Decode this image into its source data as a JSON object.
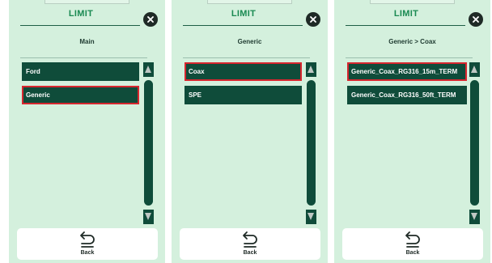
{
  "panels": [
    {
      "title": "LIMIT",
      "subtitle": "Main",
      "items": [
        "Ford",
        "Generic"
      ],
      "selected_item": "Generic",
      "back_label": "Back"
    },
    {
      "title": "LIMIT",
      "subtitle": "Generic",
      "items": [
        "Coax",
        "SPE"
      ],
      "selected_item": "Coax",
      "back_label": "Back"
    },
    {
      "title": "LIMIT",
      "subtitle": "Generic > Coax",
      "items": [
        "Generic_Coax_RG316_15m_TERM",
        "Generic_Coax_RG316_50ft_TERM"
      ],
      "selected_item": "Generic_Coax_RG316_15m_TERM",
      "back_label": "Back"
    }
  ],
  "icons": {
    "close": "close-icon",
    "back": "back-arrow-icon",
    "scroll_up": "arrow-up-icon",
    "scroll_down": "arrow-down-icon"
  },
  "colors": {
    "panel_bg": "#d4f0dd",
    "title": "#1a8a52",
    "item_bg": "#0f4c3a",
    "selected_border": "#d7262e",
    "close_bg": "#1f2a26"
  }
}
